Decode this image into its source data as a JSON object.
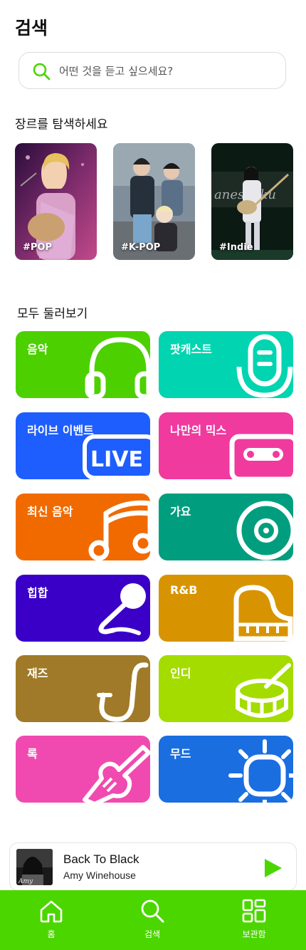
{
  "header": {
    "title": "검색"
  },
  "search": {
    "placeholder": "어떤 것을 듣고 싶으세요?",
    "value": ""
  },
  "genres": {
    "heading": "장르를 탐색하세요",
    "items": [
      {
        "label": "#POP"
      },
      {
        "label": "#K-POP"
      },
      {
        "label": "#Indie"
      }
    ]
  },
  "browse": {
    "heading": "모두 둘러보기",
    "categories": [
      {
        "label": "음악",
        "color": "#4cd000",
        "icon": "headphones-icon"
      },
      {
        "label": "팟캐스트",
        "color": "#00d4b0",
        "icon": "microphone-icon"
      },
      {
        "label": "라이브 이벤트",
        "color": "#1e5eff",
        "icon": "live-icon"
      },
      {
        "label": "나만의 믹스",
        "color": "#f03a9e",
        "icon": "cassette-icon"
      },
      {
        "label": "최신 음악",
        "color": "#f06a00",
        "icon": "music-note-icon"
      },
      {
        "label": "가요",
        "color": "#009e7e",
        "icon": "vinyl-icon"
      },
      {
        "label": "힙합",
        "color": "#3a00c8",
        "icon": "karaoke-mic-icon"
      },
      {
        "label": "R&B",
        "color": "#d89400",
        "icon": "piano-icon"
      },
      {
        "label": "재즈",
        "color": "#a07a28",
        "icon": "saxophone-icon"
      },
      {
        "label": "인디",
        "color": "#a4dc00",
        "icon": "drum-icon"
      },
      {
        "label": "록",
        "color": "#f04ab0",
        "icon": "electric-guitar-icon"
      },
      {
        "label": "무드",
        "color": "#1a6ee0",
        "icon": "sun-icon"
      }
    ]
  },
  "player": {
    "title": "Back To Black",
    "artist": "Amy Winehouse",
    "accent": "#4cd600"
  },
  "tabs": [
    {
      "label": "홈",
      "icon": "home-icon"
    },
    {
      "label": "검색",
      "icon": "search-icon"
    },
    {
      "label": "보관함",
      "icon": "library-icon"
    }
  ]
}
